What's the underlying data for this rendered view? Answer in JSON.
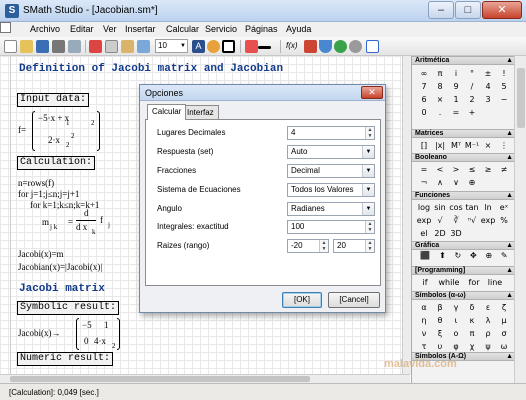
{
  "window": {
    "title": "SMath Studio - [Jacobian.sm*]"
  },
  "menu": [
    "Archivo",
    "Editar",
    "Ver",
    "Insertar",
    "Calcular",
    "Servicio",
    "Páginas",
    "Ayuda"
  ],
  "toolbar": {
    "zoom_value": "10",
    "formula_label": "f(x)"
  },
  "worksheet": {
    "heading1": "Definition of Jacobi matrix and Jacobian",
    "input_label": "Input data:",
    "f_lhs": "f=",
    "f_row1": "−5·x  + x",
    "f_row1_sub1": "1",
    "f_row1_sub2": "2",
    "f_row2": "2·x",
    "f_row2_sub1": "2",
    "f_row2_sub2": "2",
    "calc_label": "Calculation:",
    "n_line": "n=rows(f)",
    "for_j": "for  j=1;j≤n;j=j+1",
    "for_k": "for  k=1;k≤n;k=k+1",
    "m_lhs": "m",
    "m_sub": "j k",
    "deriv_d": "d",
    "deriv_den": "d x",
    "deriv_den_sub": "k",
    "deriv_f": "f",
    "deriv_f_sub": "j",
    "jacobi_def": "Jacobi(x)=m",
    "jacobian_def": "Jacobian(x)=|Jacobi(x)|",
    "heading2": "Jacobi matrix",
    "symbolic_label": "Symbolic result:",
    "jacobi_res_lhs": "Jacobi(x)→",
    "res_r1c1": "−5",
    "res_r1c2": "1",
    "res_r2c1": "0",
    "res_r2c2": "4·x",
    "res_r2c2_sub": "2",
    "numeric_label": "Numeric result:"
  },
  "panel": {
    "arith_title": "Aritmética",
    "arith_symbols": [
      "∞",
      "π",
      "i",
      "°",
      "±",
      "!",
      "7",
      "8",
      "9",
      "/",
      "4",
      "5",
      "6",
      "×",
      "1",
      "2",
      "3",
      "−",
      "0",
      ".",
      "=",
      "+"
    ],
    "matrices_title": "Matrices",
    "matrix_symbols": [
      "[]",
      "|x|",
      "Mᵀ",
      "M⁻¹",
      "×",
      "⋮"
    ],
    "boolean_title": "Booleano",
    "boolean_symbols": [
      "=",
      "<",
      ">",
      "≤",
      "≥",
      "≠",
      "¬",
      "∧",
      "∨",
      "⊕"
    ],
    "functions_title": "Funciones",
    "function_symbols": [
      "log",
      "sin",
      "cos",
      "tan",
      "ln",
      "eˣ",
      "exp",
      "√",
      "∛",
      "ⁿ√",
      "exp",
      "%",
      "el",
      "2D",
      "3D"
    ],
    "graphics_title": "Gráfica",
    "programming_title": "[Programming]",
    "prog_symbols": [
      "if",
      "while",
      "for",
      "line"
    ],
    "greek_lower_title": "Símbolos (α-ω)",
    "greek_lower_symbols": [
      "α",
      "β",
      "γ",
      "δ",
      "ε",
      "ζ",
      "η",
      "θ",
      "ι",
      "κ",
      "λ",
      "μ",
      "ν",
      "ξ",
      "ο",
      "π",
      "ρ",
      "σ",
      "τ",
      "υ",
      "φ",
      "χ",
      "ψ",
      "ω"
    ],
    "greek_upper_title": "Símbolos (Α-Ω)"
  },
  "status": {
    "text": "[Calculation]: 0,049 [sec.]"
  },
  "dialog": {
    "title": "Opciones",
    "tabs": [
      "Calcular",
      "Interfaz"
    ],
    "rows": [
      {
        "label": "Lugares Decimales",
        "value": "4"
      },
      {
        "label": "Respuesta (set)",
        "value": "Auto"
      },
      {
        "label": "Fracciones",
        "value": "Decimal"
      },
      {
        "label": "Sistema de Ecuaciones",
        "value": "Todos los Valores"
      },
      {
        "label": "Angulo",
        "value": "Radianes"
      },
      {
        "label": "Integrales: exactitud",
        "value": "100"
      },
      {
        "label": "Raizes (rango)",
        "value_min": "-20",
        "value_max": "20"
      }
    ],
    "ok_label": "[OK]",
    "cancel_label": "[Cancel]"
  },
  "watermark": "malavida.com",
  "colors": {
    "heading": "#123a8a",
    "title_gradient": "#bcd2ee",
    "close_red": "#c7432c"
  }
}
